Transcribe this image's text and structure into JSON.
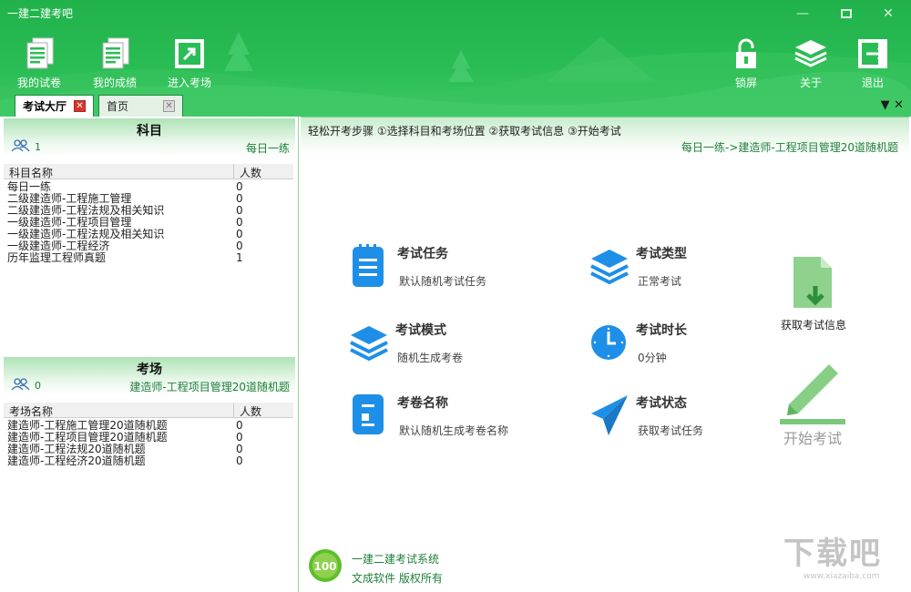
{
  "window": {
    "title": "一建二建考吧",
    "minimize_icon": "minimize-icon",
    "maximize_icon": "maximize-icon",
    "close_icon": "close-icon"
  },
  "toolbar": {
    "left": [
      {
        "label": "我的试卷",
        "icon": "document-icon"
      },
      {
        "label": "我的成绩",
        "icon": "document-icon"
      },
      {
        "label": "进入考场",
        "icon": "enter-arrow-icon"
      }
    ],
    "right": [
      {
        "label": "锁屏",
        "icon": "lock-icon"
      },
      {
        "label": "关于",
        "icon": "layers-icon"
      },
      {
        "label": "退出",
        "icon": "exit-icon"
      }
    ]
  },
  "tabs": [
    {
      "label": "考试大厅",
      "active": true
    },
    {
      "label": "首页",
      "active": false
    }
  ],
  "subjects": {
    "title": "科目",
    "count": "1",
    "selected": "每日一练",
    "col_name": "科目名称",
    "col_count": "人数",
    "rows": [
      {
        "name": "每日一练",
        "count": "0"
      },
      {
        "name": "二级建造师-工程施工管理",
        "count": "0"
      },
      {
        "name": "二级建造师-工程法规及相关知识",
        "count": "0"
      },
      {
        "name": "一级建造师-工程项目管理",
        "count": "0"
      },
      {
        "name": "一级建造师-工程法规及相关知识",
        "count": "0"
      },
      {
        "name": "一级建造师-工程经济",
        "count": "0"
      },
      {
        "name": "历年监理工程师真题",
        "count": "1"
      }
    ]
  },
  "rooms": {
    "title": "考场",
    "count": "0",
    "selected": "建造师-工程项目管理20道随机题",
    "col_name": "考场名称",
    "col_count": "人数",
    "rows": [
      {
        "name": "建造师-工程施工管理20道随机题",
        "count": "0"
      },
      {
        "name": "建造师-工程项目管理20道随机题",
        "count": "0"
      },
      {
        "name": "建造师-工程法规20道随机题",
        "count": "0"
      },
      {
        "name": "建造师-工程经济20道随机题",
        "count": "0"
      }
    ]
  },
  "main": {
    "steps": "轻松开考步骤 ①选择科目和考场位置 ②获取考试信息 ③开始考试",
    "breadcrumb": "每日一练->建造师-工程项目管理20道随机题",
    "items": [
      {
        "title": "考试任务",
        "desc": "默认随机考试任务",
        "icon": "clipboard-icon"
      },
      {
        "title": "考试类型",
        "desc": "正常考试",
        "icon": "layers-icon"
      },
      {
        "title": "考试模式",
        "desc": "随机生成考卷",
        "icon": "stack-icon"
      },
      {
        "title": "考试时长",
        "desc": "0分钟",
        "icon": "clock-icon"
      },
      {
        "title": "考卷名称",
        "desc": "默认随机生成考卷名称",
        "icon": "notebook-icon"
      },
      {
        "title": "考试状态",
        "desc": "获取考试任务",
        "icon": "paper-plane-icon"
      }
    ],
    "get_info_label": "获取考试信息",
    "start_label": "开始考试"
  },
  "footer": {
    "line1": "一建二建考试系统",
    "line2": "文成软件  版权所有",
    "logo_text": "100"
  },
  "watermark": {
    "text": "下载吧",
    "sub": "www.xiazaiba.com"
  },
  "colors": {
    "brand": "#2bbd55",
    "accent_text": "#1f7f38",
    "icon_blue": "#1e8fe8"
  }
}
